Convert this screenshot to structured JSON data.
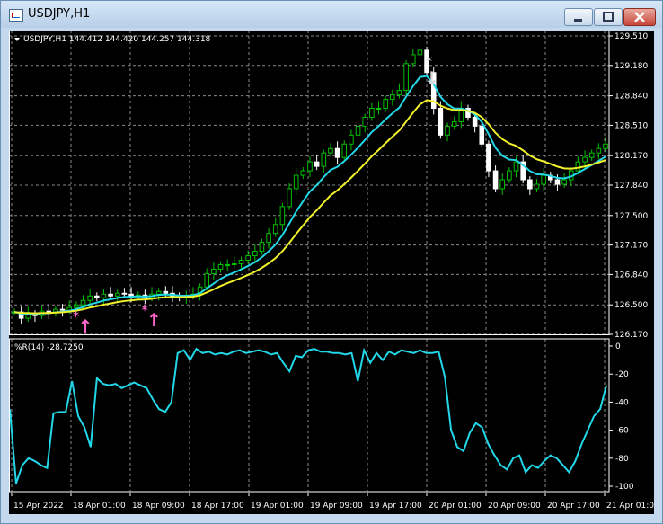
{
  "window": {
    "title": "USDJPY,H1"
  },
  "price_panel": {
    "header": "USDJPY,H1  144.412 144.420 144.257 144.318",
    "price_ticks": [
      "129.510",
      "129.180",
      "128.840",
      "128.510",
      "128.170",
      "127.840",
      "127.500",
      "127.170",
      "126.840",
      "126.500",
      "126.170"
    ]
  },
  "indicator_panel": {
    "header": "%R(14) -28.7250",
    "ticks": [
      "0",
      "-20",
      "-40",
      "-60",
      "-80",
      "-100"
    ]
  },
  "time_axis": [
    "15 Apr 2022",
    "18 Apr 01:00",
    "18 Apr 09:00",
    "18 Apr 17:00",
    "19 Apr 01:00",
    "19 Apr 09:00",
    "19 Apr 17:00",
    "20 Apr 01:00",
    "20 Apr 09:00",
    "20 Apr 17:00",
    "21 Apr 01:00"
  ],
  "colors": {
    "background": "#000000",
    "candle_up": "#00c000",
    "candle_down": "#ffffff",
    "ma_fast": "#22d7e8",
    "ma_slow": "#f2f22a",
    "wpr": "#22d7e8",
    "arrow_buy": "#ff66cc",
    "arrow_sell": "#d9d9d9",
    "grid": "#8a8a8a"
  },
  "chart_data": [
    {
      "type": "candlestick",
      "title": "USDJPY,H1",
      "ylim": [
        126.17,
        129.51
      ],
      "series": [
        {
          "name": "price",
          "close": [
            126.42,
            126.35,
            126.4,
            126.38,
            126.43,
            126.41,
            126.45,
            126.44,
            126.47,
            126.5,
            126.55,
            126.6,
            126.58,
            126.62,
            126.6,
            126.63,
            126.62,
            126.6,
            126.61,
            126.58,
            126.62,
            126.65,
            126.63,
            126.6,
            126.58,
            126.6,
            126.62,
            126.7,
            126.85,
            126.9,
            126.95,
            126.95,
            126.96,
            127.0,
            127.05,
            127.1,
            127.2,
            127.3,
            127.4,
            127.6,
            127.8,
            127.95,
            128.0,
            128.1,
            128.05,
            128.2,
            128.25,
            128.15,
            128.3,
            128.4,
            128.5,
            128.6,
            128.7,
            128.7,
            128.8,
            128.85,
            128.9,
            129.2,
            129.3,
            129.35,
            129.1,
            128.7,
            128.4,
            128.5,
            128.55,
            128.7,
            128.6,
            128.5,
            128.3,
            128.0,
            127.8,
            127.9,
            128.0,
            128.1,
            127.9,
            127.8,
            127.85,
            127.95,
            127.9,
            127.85,
            127.9,
            128.0,
            128.1,
            128.15,
            128.2,
            128.25,
            128.3
          ]
        },
        {
          "name": "ma_fast"
        },
        {
          "name": "ma_slow"
        }
      ],
      "signals": [
        {
          "kind": "buy",
          "label": "↑"
        },
        {
          "kind": "buy",
          "label": "↑"
        },
        {
          "kind": "sell",
          "label": "↓"
        }
      ]
    },
    {
      "type": "line",
      "title": "%R(14)",
      "ylim": [
        -100,
        0
      ],
      "series": [
        {
          "name": "%R(14)",
          "values": [
            -45,
            -98,
            -85,
            -80,
            -82,
            -85,
            -87,
            -48,
            -47,
            -47,
            -25,
            -50,
            -58,
            -72,
            -23,
            -27,
            -28,
            -27,
            -30,
            -28,
            -26,
            -28,
            -30,
            -38,
            -45,
            -47,
            -40,
            -5,
            -3,
            -10,
            -2,
            -5,
            -4,
            -6,
            -5,
            -6,
            -4,
            -3,
            -5,
            -4,
            -3,
            -4,
            -6,
            -5,
            -12,
            -18,
            -7,
            -8,
            -3,
            -2,
            -4,
            -4,
            -5,
            -5,
            -6,
            -5,
            -25,
            -3,
            -12,
            -5,
            -10,
            -4,
            -6,
            -3,
            -4,
            -5,
            -3,
            -5,
            -5,
            -4,
            -22,
            -60,
            -72,
            -75,
            -62,
            -55,
            -58,
            -70,
            -78,
            -85,
            -88,
            -80,
            -78,
            -90,
            -85,
            -87,
            -82,
            -78,
            -80,
            -85,
            -90,
            -82,
            -70,
            -60,
            -50,
            -45,
            -28
          ]
        }
      ]
    }
  ]
}
